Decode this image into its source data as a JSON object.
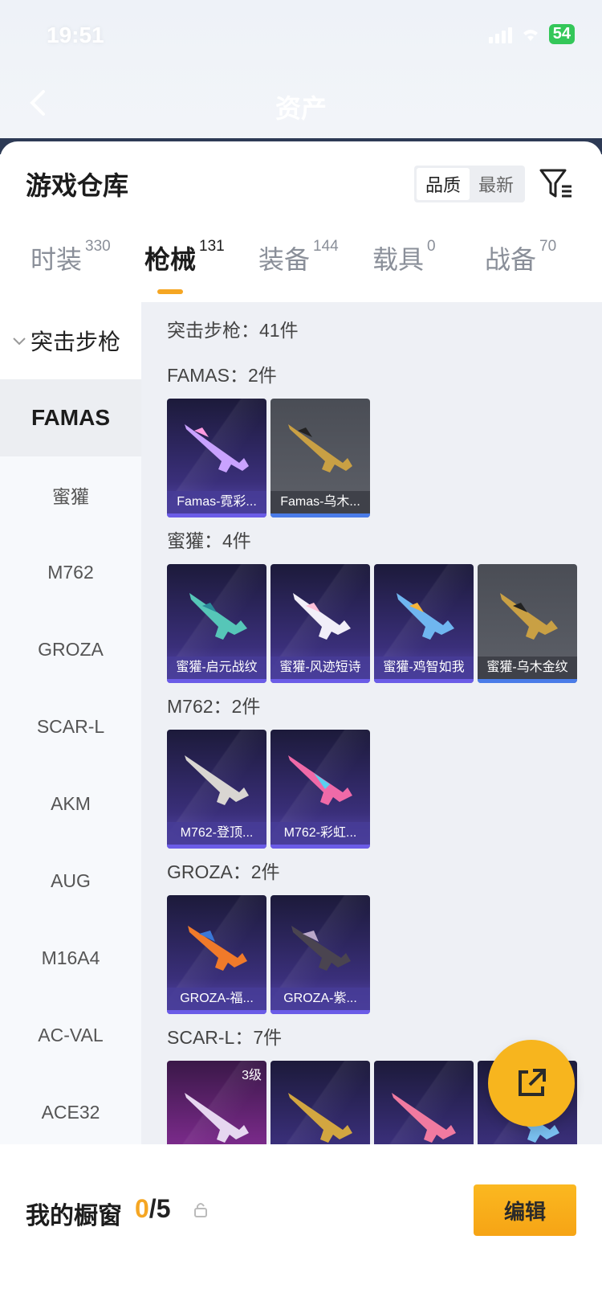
{
  "status": {
    "time": "19:51",
    "battery": "54"
  },
  "header": {
    "title": "资产"
  },
  "card": {
    "title": "游戏仓库",
    "sort": {
      "options": [
        "品质",
        "最新"
      ],
      "active": "品质"
    }
  },
  "tabs": [
    {
      "label": "时装",
      "count": "330"
    },
    {
      "label": "枪械",
      "count": "131",
      "active": true
    },
    {
      "label": "装备",
      "count": "144"
    },
    {
      "label": "载具",
      "count": "0"
    },
    {
      "label": "战备",
      "count": "70"
    }
  ],
  "sidebar": {
    "group": "突击步枪",
    "items": [
      "FAMAS",
      "蜜獾",
      "M762",
      "GROZA",
      "SCAR-L",
      "AKM",
      "AUG",
      "M16A4",
      "AC-VAL",
      "ACE32"
    ],
    "active": "FAMAS"
  },
  "content": {
    "category_header": "突击步枪：41件",
    "sections": [
      {
        "title": "FAMAS：2件",
        "items": [
          {
            "name": "Famas-霓彩...",
            "style": "purple"
          },
          {
            "name": "Famas-乌木...",
            "style": "gray"
          }
        ]
      },
      {
        "title": "蜜獾：4件",
        "items": [
          {
            "name": "蜜獾-启元战纹",
            "style": "purple"
          },
          {
            "name": "蜜獾-风迹短诗",
            "style": "purple"
          },
          {
            "name": "蜜獾-鸡智如我",
            "style": "purple"
          },
          {
            "name": "蜜獾-乌木金纹",
            "style": "gray"
          }
        ]
      },
      {
        "title": "M762：2件",
        "items": [
          {
            "name": "M762-登顶...",
            "style": "purple"
          },
          {
            "name": "M762-彩虹...",
            "style": "purple"
          }
        ]
      },
      {
        "title": "GROZA：2件",
        "items": [
          {
            "name": "GROZA-福...",
            "style": "purple"
          },
          {
            "name": "GROZA-紫...",
            "style": "purple"
          }
        ]
      },
      {
        "title": "SCAR-L：7件",
        "items": [
          {
            "level": "3级",
            "style": "pink"
          },
          {
            "style": "purple"
          },
          {
            "style": "purple"
          },
          {
            "style": "purple"
          }
        ]
      }
    ]
  },
  "showcase": {
    "label": "我的橱窗",
    "current": "0",
    "total": "/5",
    "edit_label": "编辑"
  },
  "colors": {
    "accent": "#f5a623",
    "tile_purple": "#3a2f7a",
    "tile_gray": "#55585f"
  }
}
